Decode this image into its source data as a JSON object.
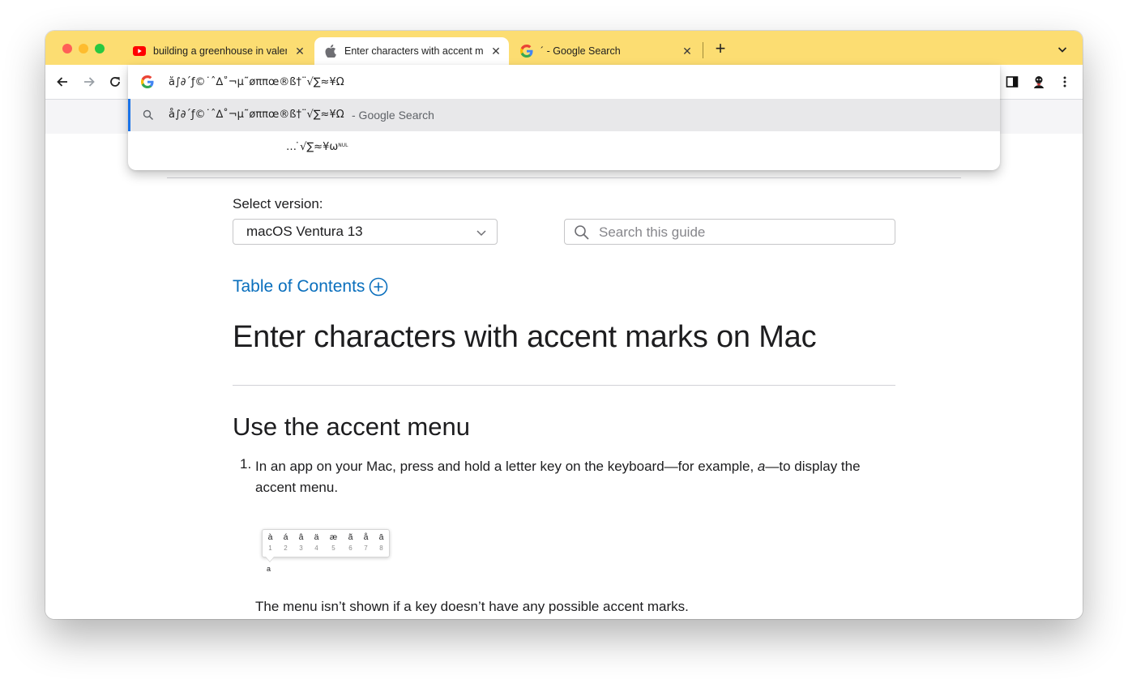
{
  "browser": {
    "tabs": [
      {
        "title": "building a greenhouse in valencia",
        "favicon": "youtube-icon",
        "close": "✕"
      },
      {
        "title": "Enter characters with accent marks on Mac",
        "favicon": "apple-icon",
        "close": "✕"
      },
      {
        "title": "´ - Google Search",
        "favicon": "google-icon",
        "close": "✕"
      }
    ],
    "new_tab": "+",
    "colors": {
      "tabstrip": "#fcdd72",
      "accent": "#1a73e8"
    }
  },
  "omnibox": {
    "value": "å∫∂´ƒ©˙ˆ∆˚¬µ˜øππœ®ß†¨√∑≈¥Ω",
    "suggestions": [
      {
        "text": "å∫∂´ƒ©˙ˆ∆˚¬µ˜øππœ®ß†¨√∑≈¥Ω",
        "suffix": "- Google Search",
        "icon": "search-icon"
      },
      {
        "text": "… ̇√∑≈¥ω",
        "sup": "NUL",
        "icon": "none"
      }
    ]
  },
  "page": {
    "select_label": "Select version:",
    "version": "macOS Ventura 13",
    "search_placeholder": "Search this guide",
    "toc": "Table of Contents",
    "title": "Enter characters with accent marks on Mac",
    "section_title": "Use the accent menu",
    "steps": [
      {
        "num": "1.",
        "before": "In an app on your Mac, press and hold a letter key on the keyboard—for example, ",
        "em": "a",
        "after": "—to display the accent menu."
      }
    ],
    "accent_menu": {
      "chars": [
        "à",
        "á",
        "â",
        "ä",
        "æ",
        "ã",
        "å",
        "ā"
      ],
      "numbers": [
        "1",
        "2",
        "3",
        "4",
        "5",
        "6",
        "7",
        "8"
      ],
      "key": "a"
    },
    "note": "The menu isn’t shown if a key doesn’t have any possible accent marks."
  }
}
